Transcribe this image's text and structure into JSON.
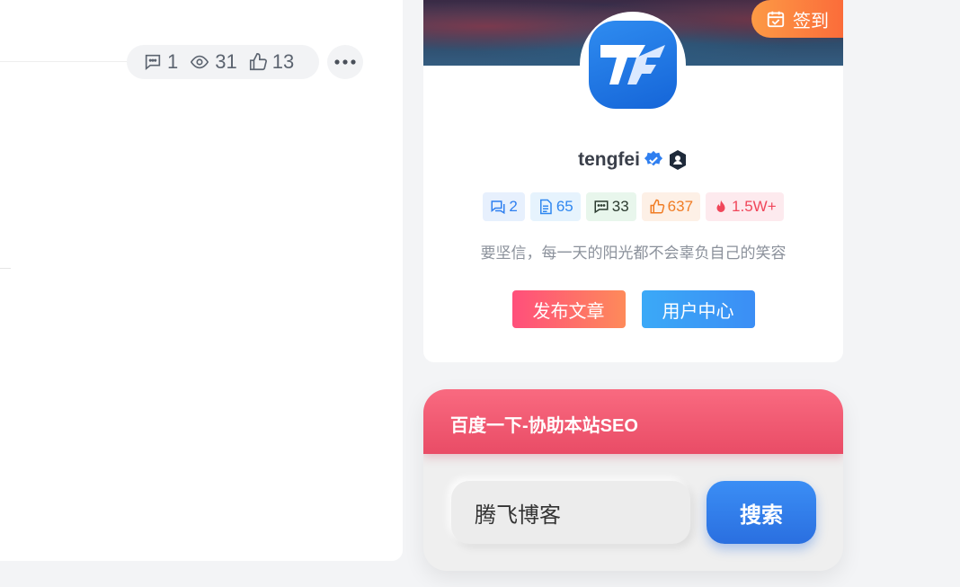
{
  "post_meta": {
    "comments": "1",
    "views": "31",
    "likes": "13"
  },
  "profile": {
    "sign_in_label": "签到",
    "username": "tengfei",
    "stats": {
      "comments_received": "2",
      "articles": "65",
      "comments_posted": "33",
      "likes": "637",
      "popularity": "1.5W+"
    },
    "bio": "要坚信，每一天的阳光都不会辜负自己的笑容",
    "publish_label": "发布文章",
    "user_center_label": "用户中心"
  },
  "seo_widget": {
    "title": "百度一下-协助本站SEO",
    "input_value": "腾飞博客",
    "search_label": "搜索"
  },
  "colors": {
    "accent_blue": "#3b8ef5",
    "accent_pink": "#ff4f7b",
    "sign_orange": "#fb6c3a"
  }
}
